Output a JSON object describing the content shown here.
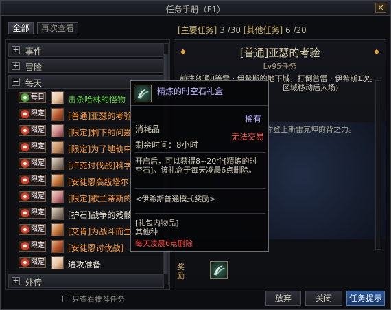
{
  "window": {
    "title": "任务手册（F1）",
    "close_glyph": "✕"
  },
  "tabs": {
    "all": "全部",
    "again": "再次查看"
  },
  "counts": {
    "main_label": "[主要任务]",
    "main_count": "3 /30",
    "other_label": "[其他任务]",
    "other_count": "6 /20"
  },
  "categories": {
    "events": "事件",
    "adventure": "冒险",
    "daily": "每天",
    "side": "外传",
    "plus": "+",
    "minus": "−"
  },
  "badges": {
    "daily": "每日",
    "limited": "限定",
    "icon": "◆"
  },
  "quests": [
    {
      "badge": "daily",
      "text": "击杀哈林的怪物",
      "color": "green"
    },
    {
      "badge": "limited",
      "text": "[普通]亚瑟的考验",
      "color": "orange"
    },
    {
      "badge": "limited",
      "text": "[限定]剩下的问题",
      "color": "orange"
    },
    {
      "badge": "limited",
      "text": "[限定]为了地轨中心",
      "color": "orange"
    },
    {
      "badge": "limited",
      "text": "[卢克讨伐战]科学",
      "color": "orange"
    },
    {
      "badge": "limited",
      "text": "[安徒恩高级塔尔",
      "color": "orange"
    },
    {
      "badge": "limited",
      "text": "[限定]歌兰蒂斯的",
      "color": "orange"
    },
    {
      "badge": "limited",
      "text": "[护石]战争的残骸",
      "color": "white"
    },
    {
      "badge": "limited",
      "text": "[艾肯]为战斗而生",
      "color": "orange"
    },
    {
      "badge": "limited",
      "text": "[安徒恩讨伐战]",
      "color": "orange"
    },
    {
      "badge": "limited",
      "text": "进攻准备",
      "color": "white"
    }
  ],
  "recommend": "只查看推荐任务",
  "detail": {
    "title": "[普通]亚瑟的考验",
    "level": "Lv95任务",
    "desc_line1": "前往普通8等雷 · 伊希斯的地下城，打倒普雷 · 伊希斯1次。",
    "desc_line2": "区域移动后入场)",
    "desc_extra": "家，在你登上斯雷克坤的背之力。",
    "arrow_left": "◆",
    "arrow_right": "◆",
    "reward_label": "奖励"
  },
  "buttons": {
    "abandon": "放弃",
    "close": "关闭",
    "hint": "任务提示"
  },
  "tooltip": {
    "name": "精炼的时空石礼盒",
    "rarity": "稀有",
    "type": "消耗品",
    "trade": "无法交易",
    "time": "剩余时间：8小时",
    "desc": "开启后，可以获得8~20个[精炼的时空石]。该礼盒于每天凌晨6点删除。",
    "mode": "<伊希斯普通模式奖励>",
    "gift_line1": "[礼包内物品]",
    "gift_line2": "其他种",
    "reset": "每天凌晨6点删除"
  },
  "colors": {
    "accent_blue": "#2c5a9a",
    "rare_purple": "#b9b3ff",
    "limited_orange": "#ff9c3a",
    "daily_green": "#5fd23e",
    "warning_red": "#ff4a3a"
  }
}
